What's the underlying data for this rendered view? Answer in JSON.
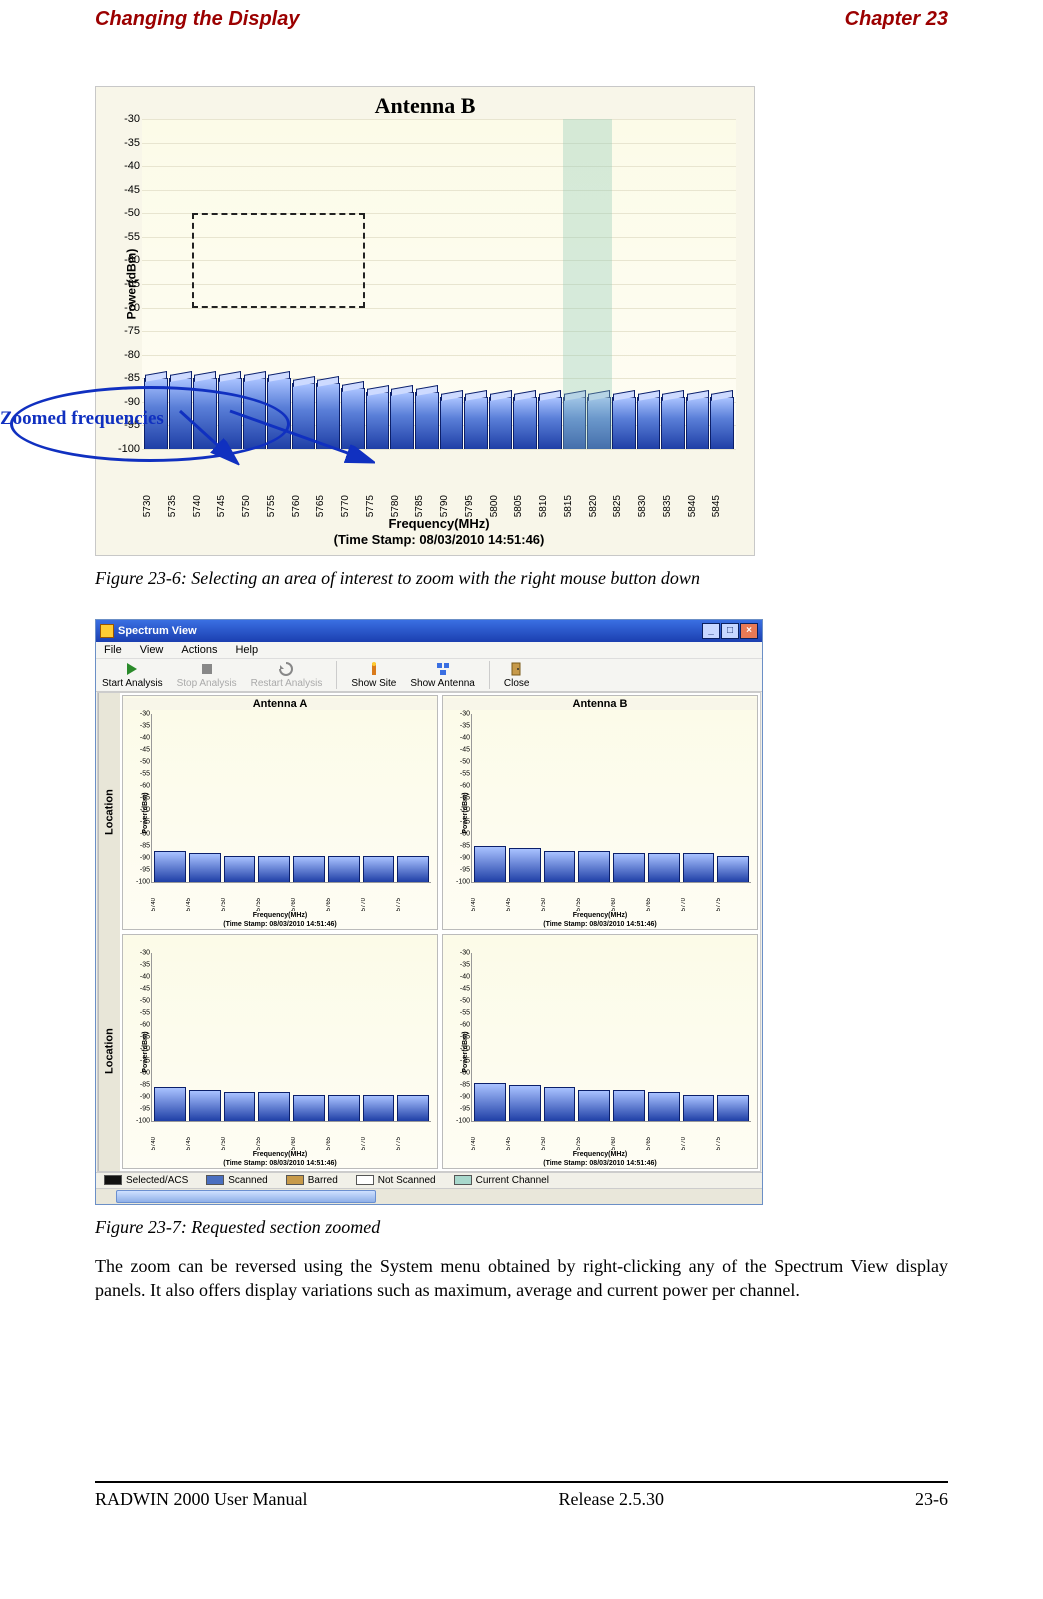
{
  "header": {
    "left": "Changing the Display",
    "right": "Chapter 23"
  },
  "fig1": {
    "title": "Antenna B",
    "yaxis_title": "Power(dBm)",
    "xaxis_title": "Frequency(MHz)",
    "timestamp": "(Time Stamp: 08/03/2010 14:51:46)",
    "annotation": "Zoomed frequencies",
    "caption": "Figure 23-6: Selecting an area of interest to zoom with the right mouse button down"
  },
  "fig2": {
    "window_title": "Spectrum View",
    "menubar": [
      "File",
      "View",
      "Actions",
      "Help"
    ],
    "toolbar": [
      {
        "icon": "play",
        "label": "Start Analysis"
      },
      {
        "icon": "stop",
        "label": "Stop Analysis"
      },
      {
        "icon": "restart",
        "label": "Restart Analysis"
      },
      {
        "icon": "site",
        "label": "Show Site"
      },
      {
        "icon": "antenna",
        "label": "Show Antenna"
      },
      {
        "icon": "door",
        "label": "Close"
      }
    ],
    "location_label": "Location",
    "legend": [
      {
        "label": "Selected/ACS",
        "color": "#111"
      },
      {
        "label": "Scanned",
        "color": "#4a6fc0"
      },
      {
        "label": "Barred",
        "color": "#c79a4a"
      },
      {
        "label": "Not Scanned",
        "color": "#ffffff"
      },
      {
        "label": "Current Channel",
        "color": "#a8d8cc"
      }
    ],
    "mini_titleA": "Antenna A",
    "mini_titleB": "Antenna B",
    "mini_yaxis": "Power(dBm)",
    "mini_xaxis": "Frequency(MHz)",
    "mini_timestamp": "(Time Stamp: 08/03/2010 14:51:46)",
    "caption": "Figure 23-7: Requested section zoomed"
  },
  "body_text": "The zoom can be reversed using the System menu obtained by right-clicking any of the Spectrum View display panels. It also offers display variations such as maximum, average and current power per channel.",
  "footer": {
    "left": "RADWIN 2000 User Manual",
    "center": "Release  2.5.30",
    "right": "23-6"
  },
  "chart_data": {
    "main": {
      "type": "bar",
      "title": "Antenna B",
      "xlabel": "Frequency(MHz)",
      "ylabel": "Power(dBm)",
      "ylim": [
        -100,
        -30
      ],
      "yticks": [
        -30,
        -35,
        -40,
        -45,
        -50,
        -55,
        -60,
        -65,
        -70,
        -75,
        -80,
        -85,
        -90,
        -95,
        -100
      ],
      "categories": [
        5730,
        5735,
        5740,
        5745,
        5750,
        5755,
        5760,
        5765,
        5770,
        5775,
        5780,
        5785,
        5790,
        5795,
        5800,
        5805,
        5810,
        5815,
        5820,
        5825,
        5830,
        5835,
        5840,
        5845
      ],
      "values": [
        -85,
        -85,
        -85,
        -85,
        -85,
        -85,
        -86,
        -86,
        -87,
        -88,
        -88,
        -88,
        -89,
        -89,
        -89,
        -89,
        -89,
        -89,
        -89,
        -89,
        -89,
        -89,
        -89,
        -89
      ],
      "highlight_range": [
        5815,
        5820
      ],
      "selection_box": {
        "x0": 5740,
        "x1": 5775,
        "y0": -50,
        "y1": -70
      }
    },
    "zoomed": {
      "type": "bar",
      "xlabel": "Frequency(MHz)",
      "ylabel": "Power(dBm)",
      "ylim": [
        -100,
        -30
      ],
      "yticks": [
        -30,
        -35,
        -40,
        -45,
        -50,
        -55,
        -60,
        -65,
        -70,
        -75,
        -80,
        -85,
        -90,
        -95,
        -100
      ],
      "categories": [
        5740,
        5745,
        5750,
        5755,
        5760,
        5765,
        5770,
        5775
      ],
      "panels": {
        "location1_antA": [
          -87,
          -88,
          -89,
          -89,
          -89,
          -89,
          -89,
          -89
        ],
        "location1_antB": [
          -85,
          -86,
          -87,
          -87,
          -88,
          -88,
          -88,
          -89
        ],
        "location2_antA": [
          -86,
          -87,
          -88,
          -88,
          -89,
          -89,
          -89,
          -89
        ],
        "location2_antB": [
          -84,
          -85,
          -86,
          -87,
          -87,
          -88,
          -89,
          -89
        ]
      }
    }
  }
}
